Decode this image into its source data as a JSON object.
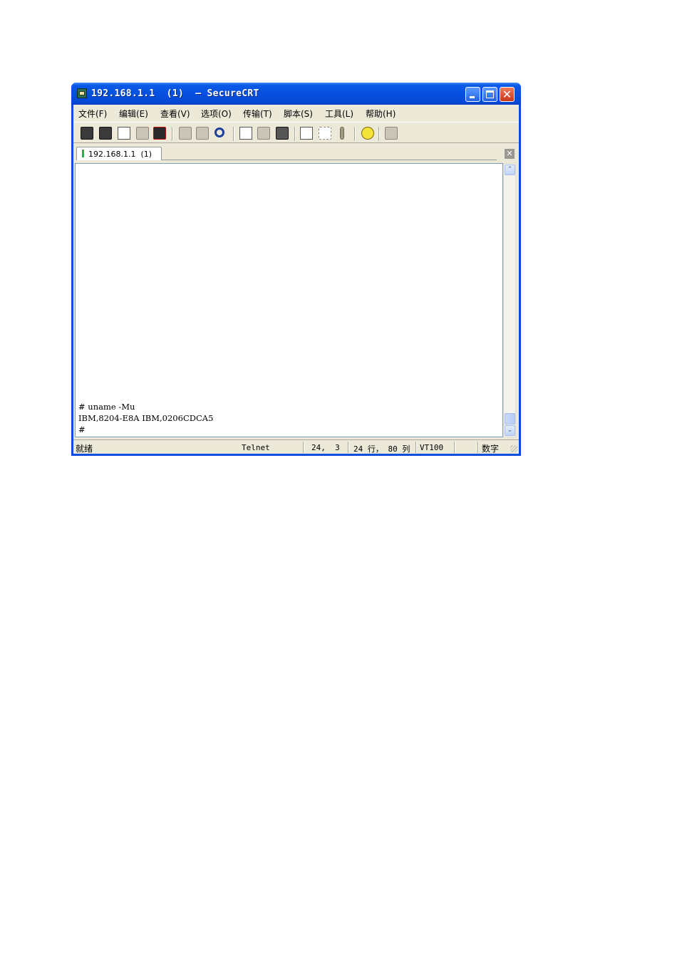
{
  "window": {
    "title": "192.168.1.1  (1)  – SecureCRT",
    "controls": {
      "minimize_icon": "minimize-icon",
      "maximize_icon": "maximize-icon",
      "close_icon": "close-icon",
      "close_glyph": "✕"
    }
  },
  "menu": {
    "items": [
      {
        "label": "文件(F)"
      },
      {
        "label": "编辑(E)"
      },
      {
        "label": "查看(V)"
      },
      {
        "label": "选项(O)"
      },
      {
        "label": "传输(T)"
      },
      {
        "label": "脚本(S)"
      },
      {
        "label": "工具(L)"
      },
      {
        "label": "帮助(H)"
      }
    ]
  },
  "toolbar": {
    "icons": [
      "connect-icon",
      "quick-connect-icon",
      "connect-in-tab-icon",
      "reconnect-icon",
      "disconnect-icon",
      "copy-icon",
      "paste-icon",
      "find-icon",
      "print-screen-icon",
      "print-selection-icon",
      "print-icon",
      "session-options-icon",
      "global-options-icon",
      "keymap-icon",
      "help-icon",
      "sftp-icon"
    ]
  },
  "tabs": {
    "active": {
      "label": "192.168.1.1  (1)"
    },
    "close_glyph": "✕"
  },
  "terminal": {
    "lines": [
      "# uname -Mu",
      "IBM,8204-E8A IBM,0206CDCA5",
      "#"
    ]
  },
  "scrollbar": {
    "up_glyph": "⌃",
    "down_glyph": "⌄"
  },
  "status": {
    "ready": "就绪",
    "protocol": "Telnet",
    "cursor": "24,  3",
    "size": "24 行， 80 列",
    "emulation": "VT100",
    "numlock": "数字"
  }
}
